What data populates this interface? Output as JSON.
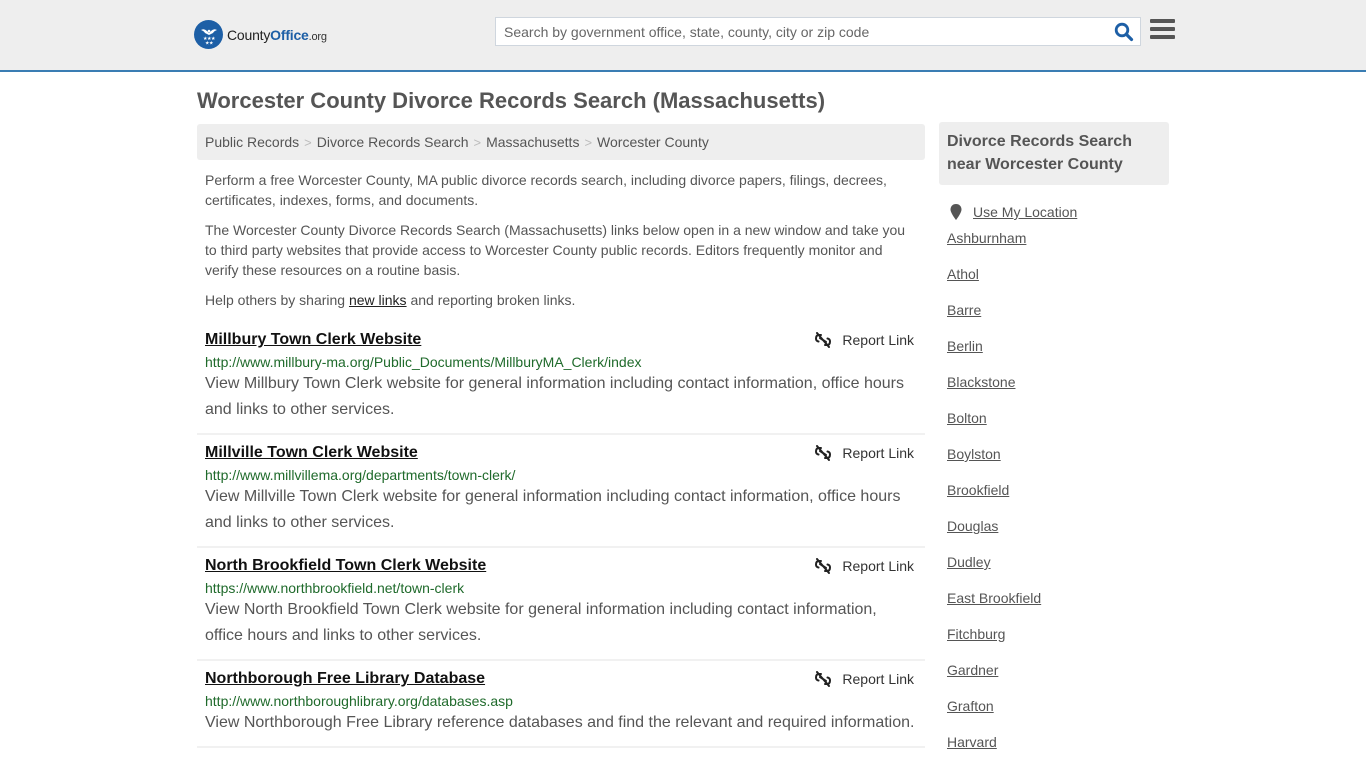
{
  "header": {
    "logo": {
      "part1": "County",
      "part2": "Office",
      "part3": ".org",
      "icon": "eagle-stars-badge-icon"
    },
    "search": {
      "placeholder": "Search by government office, state, county, city or zip code",
      "value": "",
      "icon": "search-icon"
    },
    "menu_icon": "hamburger-menu-icon"
  },
  "colors": {
    "brand_blue": "#1d5fa6",
    "header_border": "#3a7db3",
    "url_green": "#1f6a2b",
    "text_gray": "#555555",
    "panel_gray": "#eeeeee"
  },
  "page": {
    "title": "Worcester County Divorce Records Search (Massachusetts)",
    "breadcrumb": [
      {
        "label": "Public Records"
      },
      {
        "label": "Divorce Records Search"
      },
      {
        "label": "Massachusetts"
      },
      {
        "label": "Worcester County"
      }
    ],
    "breadcrumb_separator": ">",
    "intro": {
      "p1": "Perform a free Worcester County, MA public divorce records search, including divorce papers, filings, decrees, certificates, indexes, forms, and documents.",
      "p2": "The Worcester County Divorce Records Search (Massachusetts) links below open in a new window and take you to third party websites that provide access to Worcester County public records. Editors frequently monitor and verify these resources on a routine basis.",
      "p3_before": "Help others by sharing ",
      "p3_link": "new links",
      "p3_after": " and reporting broken links."
    }
  },
  "results": [
    {
      "title": "Millbury Town Clerk Website",
      "url": "http://www.millbury-ma.org/Public_Documents/MillburyMA_Clerk/index",
      "description": "View Millbury Town Clerk website for general information including contact information, office hours and links to other services.",
      "report_label": "Report Link"
    },
    {
      "title": "Millville Town Clerk Website",
      "url": "http://www.millvillema.org/departments/town-clerk/",
      "description": "View Millville Town Clerk website for general information including contact information, office hours and links to other services.",
      "report_label": "Report Link"
    },
    {
      "title": "North Brookfield Town Clerk Website",
      "url": "https://www.northbrookfield.net/town-clerk",
      "description": "View North Brookfield Town Clerk website for general information including contact information, office hours and links to other services.",
      "report_label": "Report Link"
    },
    {
      "title": "Northborough Free Library Database",
      "url": "http://www.northboroughlibrary.org/databases.asp",
      "description": "View Northborough Free Library reference databases and find the relevant and required information.",
      "report_label": "Report Link"
    }
  ],
  "sidebar": {
    "heading": "Divorce Records Search near Worcester County",
    "use_location": "Use My Location",
    "locations": [
      "Ashburnham",
      "Athol",
      "Barre",
      "Berlin",
      "Blackstone",
      "Bolton",
      "Boylston",
      "Brookfield",
      "Douglas",
      "Dudley",
      "East Brookfield",
      "Fitchburg",
      "Gardner",
      "Grafton",
      "Harvard"
    ]
  }
}
